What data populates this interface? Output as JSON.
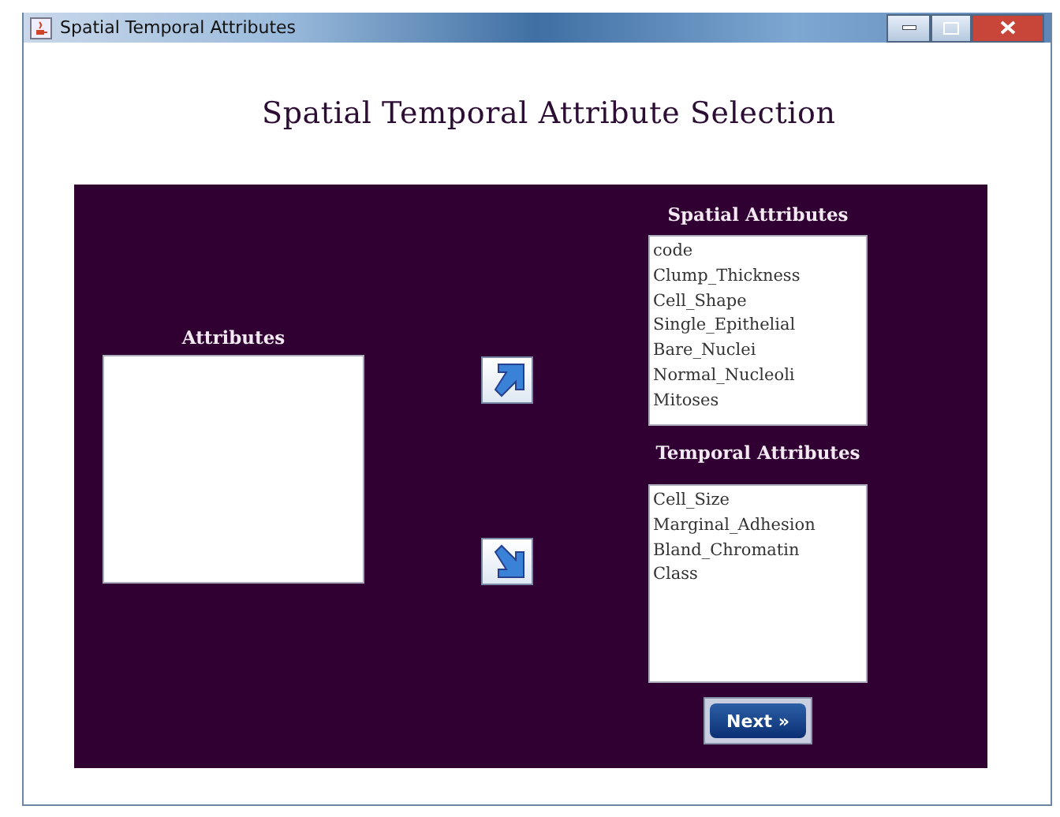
{
  "window": {
    "title": "Spatial Temporal Attributes"
  },
  "heading": "Spatial Temporal Attribute Selection",
  "attributes": {
    "label": "Attributes"
  },
  "spatial": {
    "label": "Spatial Attributes",
    "items": [
      "code",
      "Clump_Thickness",
      "Cell_Shape",
      "Single_Epithelial",
      "Bare_Nuclei",
      "Normal_Nucleoli",
      "Mitoses"
    ]
  },
  "temporal": {
    "label": "Temporal Attributes",
    "items": [
      "Cell_Size",
      "Marginal_Adhesion",
      "Bland_Chromatin",
      "Class"
    ]
  },
  "next_button": "Next »"
}
